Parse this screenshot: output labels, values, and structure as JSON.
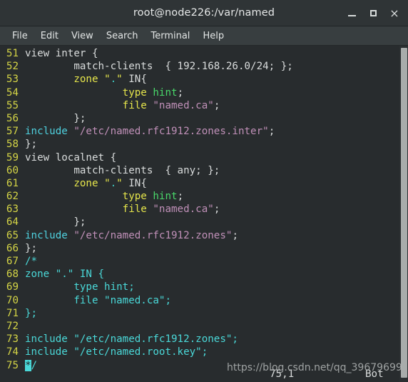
{
  "window": {
    "title": "root@node226:/var/named",
    "buttons": {
      "minimize": "minimize-icon",
      "maximize": "maximize-icon",
      "close": "×"
    }
  },
  "menubar": {
    "items": [
      {
        "label": "File"
      },
      {
        "label": "Edit"
      },
      {
        "label": "View"
      },
      {
        "label": "Search"
      },
      {
        "label": "Terminal"
      },
      {
        "label": "Help"
      }
    ]
  },
  "editor": {
    "first_line": 51,
    "lines": [
      {
        "num": "51",
        "tokens": [
          {
            "t": "view inter {",
            "c": "c-plain"
          }
        ]
      },
      {
        "num": "52",
        "tokens": [
          {
            "t": "        match-clients  { 192.168.26.0/24; };",
            "c": "c-plain"
          }
        ]
      },
      {
        "num": "53",
        "tokens": [
          {
            "t": "        ",
            "c": "c-plain"
          },
          {
            "t": "zone",
            "c": "c-kw"
          },
          {
            "t": " ",
            "c": "c-plain"
          },
          {
            "t": "\"",
            "c": "c-kw"
          },
          {
            "t": ".",
            "c": "c-dot"
          },
          {
            "t": "\"",
            "c": "c-kw"
          },
          {
            "t": " IN{",
            "c": "c-plain"
          }
        ]
      },
      {
        "num": "54",
        "tokens": [
          {
            "t": "                ",
            "c": "c-plain"
          },
          {
            "t": "type",
            "c": "c-kw"
          },
          {
            "t": " ",
            "c": "c-plain"
          },
          {
            "t": "hint",
            "c": "c-green"
          },
          {
            "t": ";",
            "c": "c-plain"
          }
        ]
      },
      {
        "num": "55",
        "tokens": [
          {
            "t": "                ",
            "c": "c-plain"
          },
          {
            "t": "file",
            "c": "c-kw"
          },
          {
            "t": " ",
            "c": "c-plain"
          },
          {
            "t": "\"named.ca\"",
            "c": "c-str"
          },
          {
            "t": ";",
            "c": "c-plain"
          }
        ]
      },
      {
        "num": "56",
        "tokens": [
          {
            "t": "        };",
            "c": "c-plain"
          }
        ]
      },
      {
        "num": "57",
        "tokens": [
          {
            "t": "include",
            "c": "c-inc"
          },
          {
            "t": " ",
            "c": "c-plain"
          },
          {
            "t": "\"/etc/named.rfc1912.zones.inter\"",
            "c": "c-str"
          },
          {
            "t": ";",
            "c": "c-plain"
          }
        ]
      },
      {
        "num": "58",
        "tokens": [
          {
            "t": "};",
            "c": "c-plain"
          }
        ]
      },
      {
        "num": "59",
        "tokens": [
          {
            "t": "view localnet {",
            "c": "c-plain"
          }
        ]
      },
      {
        "num": "60",
        "tokens": [
          {
            "t": "        match-clients  { any; };",
            "c": "c-plain"
          }
        ]
      },
      {
        "num": "61",
        "tokens": [
          {
            "t": "        ",
            "c": "c-plain"
          },
          {
            "t": "zone",
            "c": "c-kw"
          },
          {
            "t": " ",
            "c": "c-plain"
          },
          {
            "t": "\"",
            "c": "c-kw"
          },
          {
            "t": ".",
            "c": "c-dot"
          },
          {
            "t": "\"",
            "c": "c-kw"
          },
          {
            "t": " IN{",
            "c": "c-plain"
          }
        ]
      },
      {
        "num": "62",
        "tokens": [
          {
            "t": "                ",
            "c": "c-plain"
          },
          {
            "t": "type",
            "c": "c-kw"
          },
          {
            "t": " ",
            "c": "c-plain"
          },
          {
            "t": "hint",
            "c": "c-green"
          },
          {
            "t": ";",
            "c": "c-plain"
          }
        ]
      },
      {
        "num": "63",
        "tokens": [
          {
            "t": "                ",
            "c": "c-plain"
          },
          {
            "t": "file",
            "c": "c-kw"
          },
          {
            "t": " ",
            "c": "c-plain"
          },
          {
            "t": "\"named.ca\"",
            "c": "c-str"
          },
          {
            "t": ";",
            "c": "c-plain"
          }
        ]
      },
      {
        "num": "64",
        "tokens": [
          {
            "t": "        };",
            "c": "c-plain"
          }
        ]
      },
      {
        "num": "65",
        "tokens": [
          {
            "t": "include",
            "c": "c-inc"
          },
          {
            "t": " ",
            "c": "c-plain"
          },
          {
            "t": "\"/etc/named.rfc1912.zones\"",
            "c": "c-str"
          },
          {
            "t": ";",
            "c": "c-plain"
          }
        ]
      },
      {
        "num": "66",
        "tokens": [
          {
            "t": "};",
            "c": "c-plain"
          }
        ]
      },
      {
        "num": "67",
        "tokens": [
          {
            "t": "/*",
            "c": "c-cyan"
          }
        ]
      },
      {
        "num": "68",
        "tokens": [
          {
            "t": "zone \".\" IN {",
            "c": "c-cyan"
          }
        ]
      },
      {
        "num": "69",
        "tokens": [
          {
            "t": "        type hint;",
            "c": "c-cyan"
          }
        ]
      },
      {
        "num": "70",
        "tokens": [
          {
            "t": "        file \"named.ca\";",
            "c": "c-cyan"
          }
        ]
      },
      {
        "num": "71",
        "tokens": [
          {
            "t": "};",
            "c": "c-cyan"
          }
        ]
      },
      {
        "num": "72",
        "tokens": [
          {
            "t": "",
            "c": "c-plain"
          }
        ]
      },
      {
        "num": "73",
        "tokens": [
          {
            "t": "include \"/etc/named.rfc1912.zones\";",
            "c": "c-cyan"
          }
        ]
      },
      {
        "num": "74",
        "tokens": [
          {
            "t": "include \"/etc/named.root.key\";",
            "c": "c-cyan"
          }
        ]
      },
      {
        "num": "75",
        "tokens": [
          {
            "t": "*",
            "c": "cursor"
          },
          {
            "t": "/",
            "c": "c-cyan"
          }
        ]
      }
    ]
  },
  "status": {
    "position": "75,1",
    "location": "Bot"
  },
  "watermark": {
    "text": "https://blog.csdn.net/qq_39679699"
  },
  "colors": {
    "background": "#282c2e",
    "titlebar": "#2f3436",
    "menubar": "#383e40",
    "linenumber": "#d4d446",
    "keyword": "#e5e54b",
    "include": "#4fd2e0",
    "string": "#c090b8",
    "green": "#49d86a",
    "comment": "#4ad8d8",
    "scrollbar": "#a8acab"
  }
}
